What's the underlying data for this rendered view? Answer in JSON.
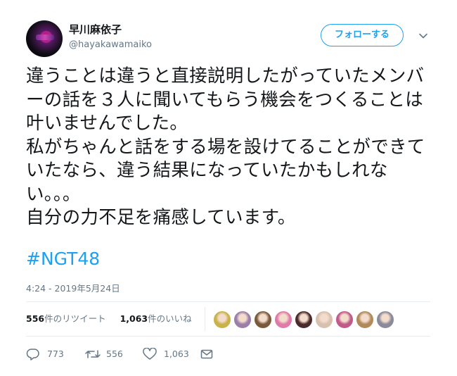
{
  "user": {
    "display_name": "早川麻依子",
    "handle": "@hayakawamaiko"
  },
  "follow_button": {
    "label": "フォローする"
  },
  "tweet": {
    "text": "違うことは違うと直接説明したがっていたメンバーの話を３人に聞いてもらう機会をつくることは叶いませんでした。\n私がちゃんと話をする場を設けてることができていたなら、違う結果になっていたかもしれない。。。\n自分の力不足を痛感しています。",
    "hashtag": "#NGT48",
    "timestamp": "4:24 - 2019年5月24日"
  },
  "stats": {
    "retweet_count": "556",
    "retweet_label": "件のリツイート",
    "like_count": "1,063",
    "like_label": "件のいいね"
  },
  "liker_avatar_colors": [
    "#c9b24a",
    "#9b7fa8",
    "#7a5a3a",
    "#e07aa8",
    "#4a2a2a",
    "#d8c0b0",
    "#c05a8a",
    "#b08a5a",
    "#8a8a9a"
  ],
  "actions": {
    "reply_count": "773",
    "retweet_count": "556",
    "like_count": "1,063"
  },
  "icons": {
    "avatar": "profile-avatar",
    "chevron": "chevron-down-icon",
    "reply": "reply-icon",
    "retweet": "retweet-icon",
    "like": "heart-icon",
    "dm": "envelope-icon"
  },
  "colors": {
    "accent": "#1da1f2",
    "text": "#14171a",
    "muted": "#657786"
  }
}
